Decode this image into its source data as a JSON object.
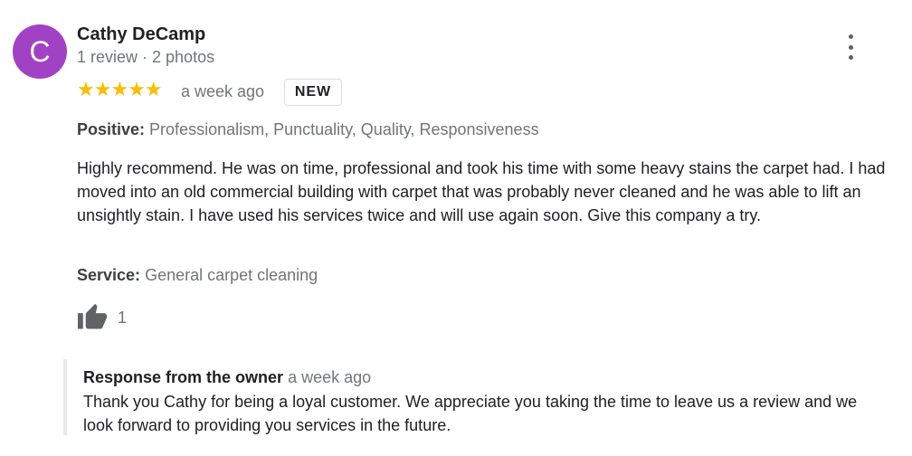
{
  "review": {
    "avatar_letter": "C",
    "avatar_color": "#a142c4",
    "reviewer_name": "Cathy DeCamp",
    "reviewer_meta": "1 review · 2 photos",
    "menu_icon": "more-vert-icon",
    "rating": 5,
    "rating_stars": "★★★★★",
    "star_color": "#fbbc04",
    "time_ago": "a week ago",
    "badge": "NEW",
    "positive_label": "Positive:",
    "positive_values": "Professionalism, Punctuality, Quality, Responsiveness",
    "text": "Highly recommend. He was on time, professional and took his time with some heavy stains the carpet had. I had moved into an old commercial building with carpet that was probably never cleaned and he was able to lift an unsightly stain. I have used his services twice and will use again soon. Give this company a try.",
    "service_label": "Service:",
    "service_value": "General carpet cleaning",
    "like_icon": "thumbs-up-icon",
    "like_count": "1"
  },
  "owner_response": {
    "title": "Response from the owner",
    "time_ago": "a week ago",
    "text": "Thank you Cathy for being a loyal customer. We appreciate you taking the time to leave us a review and we look forward to providing you services in the future."
  }
}
